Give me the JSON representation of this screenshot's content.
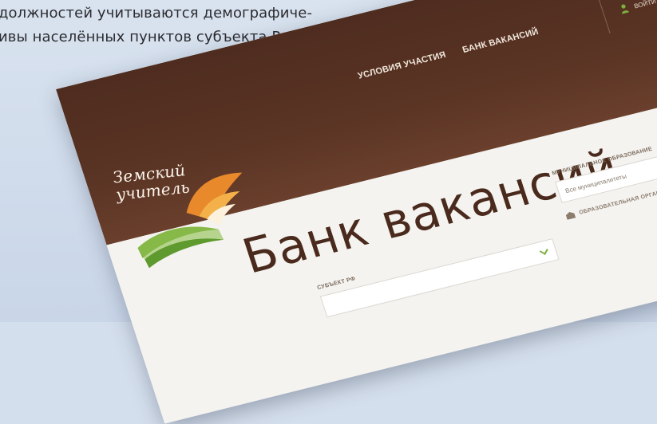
{
  "document": {
    "lines": [
      "должностей учитываются демографиче-",
      "ивы населённых пунктов субъекта Рос-"
    ]
  },
  "site": {
    "logo": {
      "line1": "Земский",
      "line2": "учитель"
    },
    "nav": {
      "conditions": "УСЛОВИЯ УЧАСТИЯ",
      "vacancies": "БАНК ВАКАНСИЙ"
    },
    "user": {
      "label": "ВОЙТИ"
    },
    "page_title": "Банк вакансий",
    "filters": {
      "region_label": "СУБЪЕКТ РФ",
      "region_value": "",
      "municipality_label": "МУНИЦИПАЛЬНОЕ ОБРАЗОВАНИЕ",
      "municipality_value": "Все муниципалитеты",
      "school_label": "ОБРАЗОВАТЕЛЬНАЯ ОРГАНИЗАЦИЯ"
    }
  },
  "colors": {
    "header_brown": "#52301f",
    "title_brown": "#4a2a1c",
    "accent_green": "#7bb03f",
    "accent_orange": "#e8892b",
    "page_bg": "#d4dfed"
  }
}
